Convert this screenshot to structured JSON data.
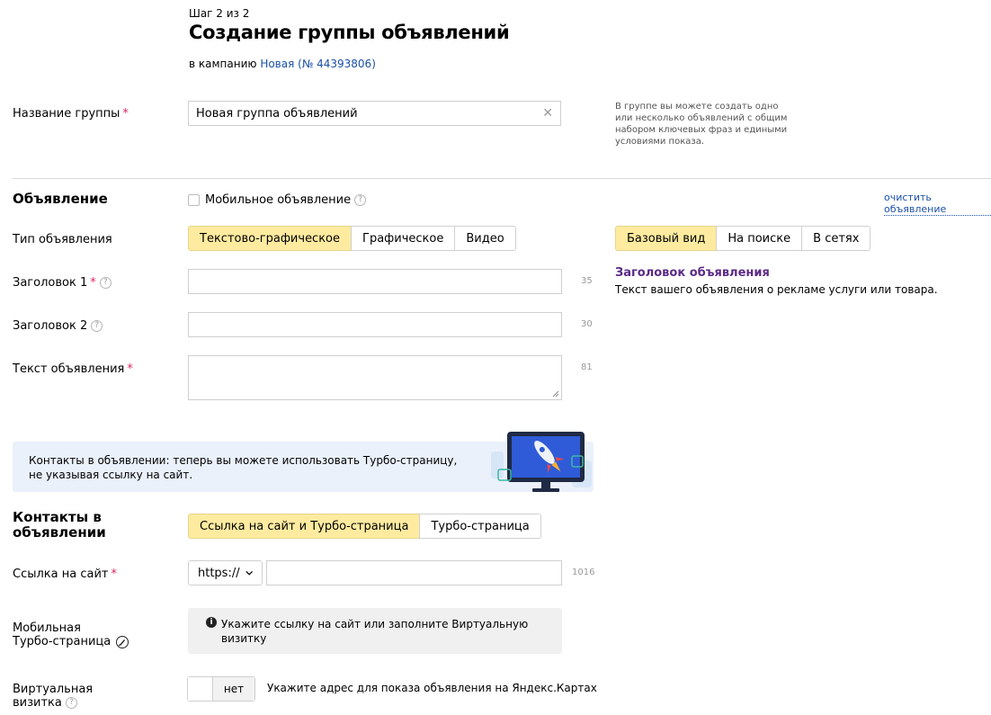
{
  "header": {
    "step": "Шаг 2 из 2",
    "title": "Создание группы объявлений",
    "campaign_prefix": "в кампанию ",
    "campaign_link": "Новая (№ 44393806)"
  },
  "group": {
    "label": "Название группы",
    "required_mark": "*",
    "value": "Новая группа объявлений",
    "clear_icon": "close-icon",
    "hint": "В группе вы можете создать одно или несколько объявлений с общим набором ключевых фраз и едиными условиями показа."
  },
  "ad": {
    "section_title": "Объявление",
    "mobile_checkbox_label": "Мобильное объявление",
    "clear_link": "очистить объявление",
    "type_label": "Тип объявления",
    "type_options": [
      "Текстово-графическое",
      "Графическое",
      "Видео"
    ],
    "type_selected": 0,
    "view_options": [
      "Базовый вид",
      "На поиске",
      "В сетях"
    ],
    "view_selected": 0,
    "headline1_label": "Заголовок 1",
    "headline1_counter": "35",
    "headline2_label": "Заголовок 2",
    "headline2_counter": "30",
    "text_label": "Текст объявления",
    "text_counter": "81",
    "preview_title": "Заголовок объявления",
    "preview_text": "Текст вашего объявления о рекламе услуги или товара."
  },
  "banner": {
    "line1": "Контакты в объявлении: теперь вы можете использовать Турбо-страницу,",
    "line2": "не указывая ссылку на сайт."
  },
  "contacts": {
    "section_title_1": "Контакты в",
    "section_title_2": "объявлении",
    "options": [
      "Ссылка на сайт и Турбо-страница",
      "Турбо-страница"
    ],
    "selected": 0,
    "site_label": "Ссылка на сайт",
    "protocol": "https://",
    "site_counter": "1016",
    "turbo_label_1": "Мобильная",
    "turbo_label_2": "Турбо-страница",
    "turbo_info": "Укажите ссылку на сайт или заполните Виртуальную визитку",
    "vcard_label_1": "Виртуальная",
    "vcard_label_2": "визитка",
    "vcard_toggle": "нет",
    "vcard_hint": "Укажите адрес для показа объявления на Яндекс.Картах"
  },
  "colors": {
    "accent_yellow": "#ffeba0",
    "link_blue": "#1a4fa8",
    "preview_purple": "#5b2a86",
    "required_red": "#e0245e"
  }
}
